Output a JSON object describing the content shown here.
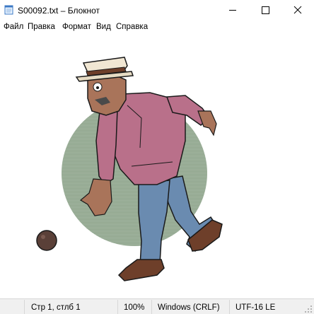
{
  "window": {
    "title": "S00092.txt – Блокнот",
    "icon": "notepad-icon"
  },
  "title_buttons": {
    "minimize_icon": "minimize-icon",
    "maximize_icon": "maximize-icon",
    "close_icon": "close-icon"
  },
  "menu": {
    "items": [
      "Файл",
      "Правка",
      "Формат",
      "Вид",
      "Справка"
    ]
  },
  "editor": {
    "content": "ascii-art-illustration-bowler-man-rolling-ball"
  },
  "status": {
    "position": "Стр 1, стлб 1",
    "zoom": "100%",
    "line_endings": "Windows (CRLF)",
    "encoding": "UTF-16 LE"
  },
  "colors": {
    "background_circle": "#8fa58c",
    "shirt": "#b9708a",
    "jeans": "#6a8bb0",
    "shoes": "#6e3f2a",
    "skin": "#a9745a",
    "ball": "#5a4038",
    "statusbar": "#f0f0f0"
  }
}
